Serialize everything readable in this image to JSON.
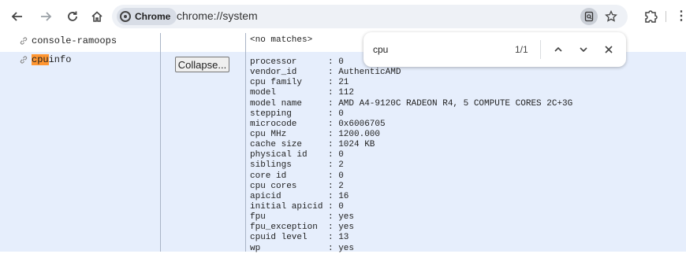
{
  "browser": {
    "chip_label": "Chrome",
    "url": "chrome://system"
  },
  "find_bar": {
    "query": "cpu",
    "count": "1/1"
  },
  "rows": [
    {
      "name": "console-ramoops",
      "value": "<no matches>"
    },
    {
      "name_highlight": "cpu",
      "name_rest": "info",
      "button_label": "Collapse...",
      "details": [
        {
          "key": "processor",
          "value": ": 0"
        },
        {
          "key": "vendor_id",
          "value": ": AuthenticAMD"
        },
        {
          "key": "cpu family",
          "value": ": 21"
        },
        {
          "key": "model",
          "value": ": 112"
        },
        {
          "key": "model name",
          "value": ": AMD A4-9120C RADEON R4, 5 COMPUTE CORES 2C+3G"
        },
        {
          "key": "stepping",
          "value": ": 0"
        },
        {
          "key": "microcode",
          "value": ": 0x6006705"
        },
        {
          "key": "cpu MHz",
          "value": ": 1200.000"
        },
        {
          "key": "cache size",
          "value": ": 1024 KB"
        },
        {
          "key": "physical id",
          "value": ": 0"
        },
        {
          "key": "siblings",
          "value": ": 2"
        },
        {
          "key": "core id",
          "value": ": 0"
        },
        {
          "key": "cpu cores",
          "value": ": 2"
        },
        {
          "key": "apicid",
          "value": ": 16"
        },
        {
          "key": "initial apicid",
          "value": ": 0"
        },
        {
          "key": "fpu",
          "value": ": yes"
        },
        {
          "key": "fpu_exception",
          "value": ": yes"
        },
        {
          "key": "cpuid level",
          "value": ": 13"
        },
        {
          "key": "wp",
          "value": ": yes"
        }
      ]
    }
  ],
  "colors": {
    "highlight": "#ff9632",
    "row_background": "#e6eefc"
  }
}
